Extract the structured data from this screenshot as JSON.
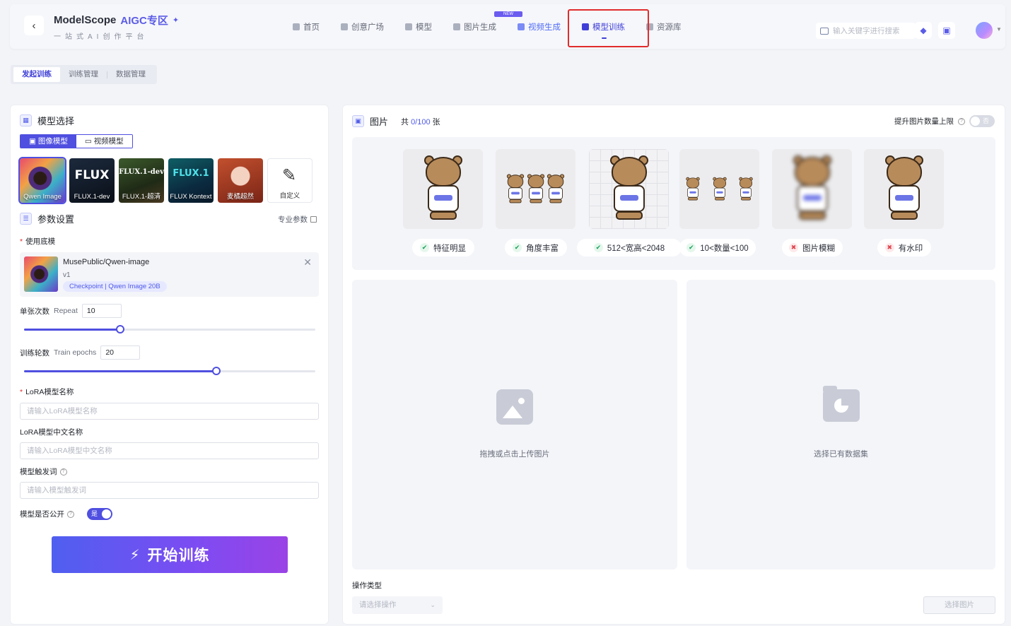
{
  "header": {
    "back_glyph": "‹",
    "brand": "ModelScope",
    "brand_tag": "AIGC专区",
    "slogan": "一站式AI创作平台",
    "badge": "NEW",
    "nav": [
      {
        "label": "首页",
        "icon": "home-icon"
      },
      {
        "label": "创意广场",
        "icon": "palette-icon"
      },
      {
        "label": "模型",
        "icon": "cube-icon"
      },
      {
        "label": "图片生成",
        "icon": "image-icon"
      },
      {
        "label": "视频生成",
        "icon": "video-icon"
      },
      {
        "label": "模型训练",
        "icon": "train-icon",
        "active": true
      },
      {
        "label": "资源库",
        "icon": "library-icon"
      }
    ],
    "search_placeholder": "输入关键字进行搜索"
  },
  "subtabs": [
    "发起训练",
    "训练管理",
    "数据管理"
  ],
  "left": {
    "model_section_title": "模型选择",
    "model_types": [
      "图像模型",
      "视频模型"
    ],
    "models": [
      {
        "title": "",
        "label": "Qwen Image"
      },
      {
        "title": "FLUX",
        "label": "FLUX.1-dev"
      },
      {
        "title": "FLUX.1-dev",
        "label": "FLUX.1-超清"
      },
      {
        "title": "FLUX.1",
        "label": "FLUX Kontext"
      },
      {
        "title": "",
        "label": "麦橘超然"
      },
      {
        "title": "",
        "label": "自定义"
      }
    ],
    "param_section_title": "参数设置",
    "pro_params": "专业参数",
    "base_model_label": "使用底模",
    "base_model": {
      "name": "MusePublic/Qwen-image",
      "version": "v1",
      "tag": "Checkpoint | Qwen Image 20B"
    },
    "repeat": {
      "label": "单张次数",
      "en": "Repeat",
      "value": "10",
      "fraction": 0.33
    },
    "epochs": {
      "label": "训练轮数",
      "en": "Train epochs",
      "value": "20",
      "fraction": 0.66
    },
    "lora_name": {
      "label": "LoRA模型名称",
      "placeholder": "请输入LoRA模型名称"
    },
    "lora_cn_name": {
      "label": "LoRA模型中文名称",
      "placeholder": "请输入LoRA模型中文名称"
    },
    "trigger": {
      "label": "模型触发词",
      "placeholder": "请输入模型触发词"
    },
    "public": {
      "label": "模型是否公开",
      "value": "是"
    },
    "train_button": "开始训练"
  },
  "right": {
    "title": "图片",
    "count_prefix": "共",
    "count": "0/100",
    "count_suffix": "张",
    "limit_label": "提升图片数量上限",
    "limit_value": "否",
    "guides": [
      {
        "label": "特征明显",
        "ok": true
      },
      {
        "label": "角度丰富",
        "ok": true
      },
      {
        "label": "512<宽高<2048",
        "ok": true
      },
      {
        "label": "10<数量<100",
        "ok": true
      },
      {
        "label": "图片模糊",
        "ok": false
      },
      {
        "label": "有水印",
        "ok": false
      }
    ],
    "upload_text": "拖拽或点击上传图片",
    "dataset_text": "选择已有数据集",
    "op_label": "操作类型",
    "op_placeholder": "请选择操作",
    "pick_button": "选择图片"
  }
}
